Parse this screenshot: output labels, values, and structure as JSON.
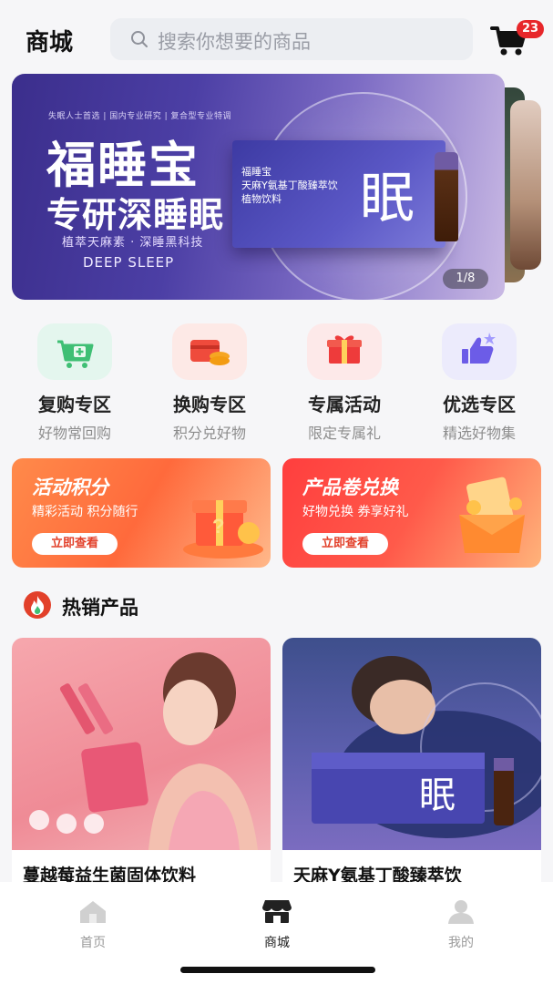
{
  "header": {
    "title": "商城",
    "search_placeholder": "搜索你想要的商品",
    "cart_badge": "23"
  },
  "banner": {
    "top_line": "失眠人士首选 | 国内专业研究 | 复合型专业特调",
    "headline1": "福睡宝",
    "headline2": "专研深睡眠",
    "subline": "植萃天麻素 · 深睡黑科技",
    "english": "DEEP SLEEP",
    "box_text": "福睡宝\n天麻Y氨基丁酸臻萃饮\n植物饮料",
    "box_char": "眠",
    "pager": "1/8"
  },
  "categories": [
    {
      "name": "复购专区",
      "desc": "好物常回购",
      "icon": "cart-plus-icon",
      "bg": "#e4f6ee"
    },
    {
      "name": "换购专区",
      "desc": "积分兑好物",
      "icon": "wallet-coins-icon",
      "bg": "#fde9e6"
    },
    {
      "name": "专属活动",
      "desc": "限定专属礼",
      "icon": "gift-icon",
      "bg": "#fde9e9"
    },
    {
      "name": "优选专区",
      "desc": "精选好物集",
      "icon": "thumbs-up-icon",
      "bg": "#ecebfc"
    }
  ],
  "promos": [
    {
      "title": "活动积分",
      "sub": "精彩活动 积分随行",
      "button": "立即查看"
    },
    {
      "title": "产品卷兑换",
      "sub": "好物兑换 券享好礼",
      "button": "立即查看"
    }
  ],
  "hot": {
    "title": "热销产品",
    "icon": "flame-icon"
  },
  "products": [
    {
      "name": "蔓越莓益生菌固体饮料"
    },
    {
      "name": "天麻Y氨基丁酸臻萃饮"
    }
  ],
  "tabs": [
    {
      "label": "首页",
      "icon": "home-icon"
    },
    {
      "label": "商城",
      "icon": "store-icon"
    },
    {
      "label": "我的",
      "icon": "user-icon"
    }
  ],
  "colors": {
    "accent_red": "#e7262a",
    "cart_black": "#111111",
    "banner_purple": "#4c3fa5"
  }
}
